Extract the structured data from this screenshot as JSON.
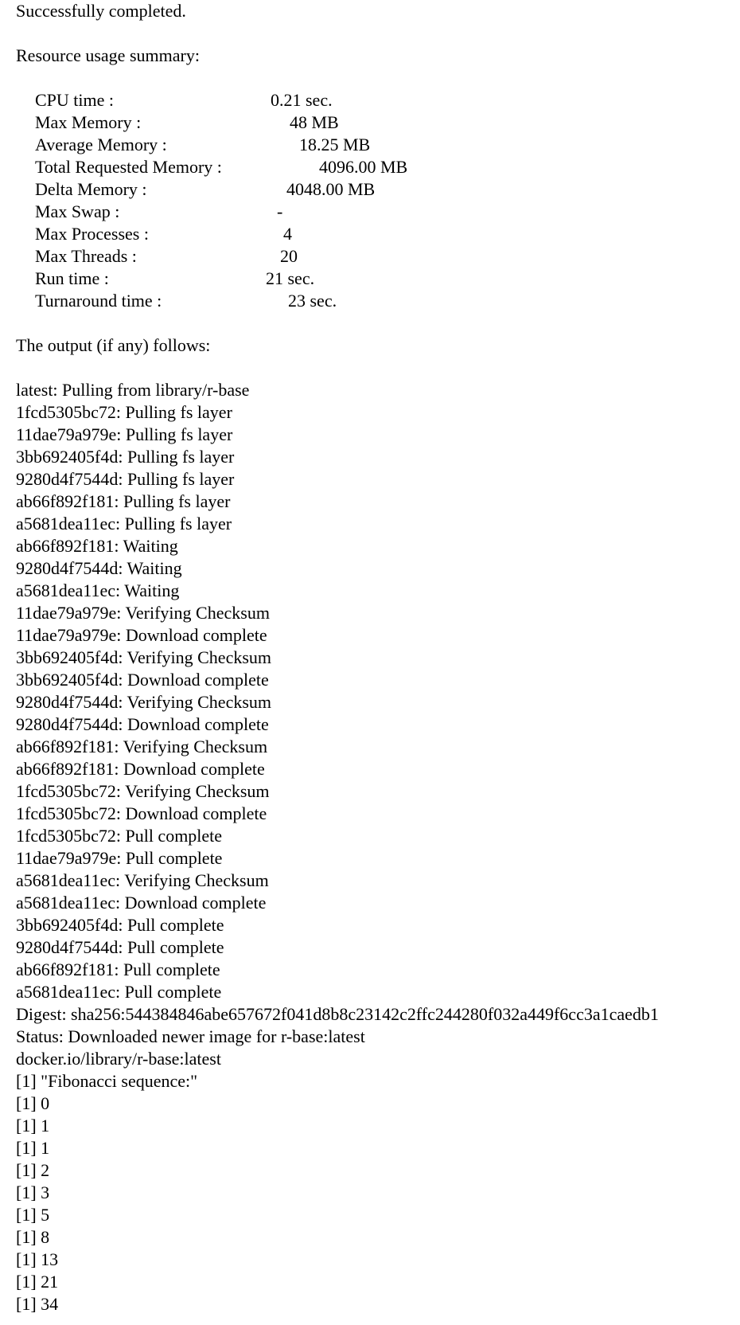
{
  "status_message": "Successfully completed.",
  "summary_heading": "Resource usage summary:",
  "usage": [
    {
      "label": "CPU time :",
      "value": "0.21 sec."
    },
    {
      "label": "Max Memory :",
      "value": "48 MB"
    },
    {
      "label": "Average Memory :",
      "value": "18.25 MB"
    },
    {
      "label": "Total Requested Memory :",
      "value": "4096.00 MB"
    },
    {
      "label": "Delta Memory :",
      "value": "4048.00 MB"
    },
    {
      "label": "Max Swap :",
      "value": "-"
    },
    {
      "label": "Max Processes :",
      "value": "4"
    },
    {
      "label": "Max Threads :",
      "value": "20"
    },
    {
      "label": "Run time :",
      "value": "21 sec."
    },
    {
      "label": "Turnaround time :",
      "value": "23 sec."
    }
  ],
  "output_heading": "The output (if any) follows:",
  "output_lines": [
    "latest: Pulling from library/r-base",
    "1fcd5305bc72: Pulling fs layer",
    "11dae79a979e: Pulling fs layer",
    "3bb692405f4d: Pulling fs layer",
    "9280d4f7544d: Pulling fs layer",
    "ab66f892f181: Pulling fs layer",
    "a5681dea11ec: Pulling fs layer",
    "ab66f892f181: Waiting",
    "9280d4f7544d: Waiting",
    "a5681dea11ec: Waiting",
    "11dae79a979e: Verifying Checksum",
    "11dae79a979e: Download complete",
    "3bb692405f4d: Verifying Checksum",
    "3bb692405f4d: Download complete",
    "9280d4f7544d: Verifying Checksum",
    "9280d4f7544d: Download complete",
    "ab66f892f181: Verifying Checksum",
    "ab66f892f181: Download complete",
    "1fcd5305bc72: Verifying Checksum",
    "1fcd5305bc72: Download complete",
    "1fcd5305bc72: Pull complete",
    "11dae79a979e: Pull complete",
    "a5681dea11ec: Verifying Checksum",
    "a5681dea11ec: Download complete",
    "3bb692405f4d: Pull complete",
    "9280d4f7544d: Pull complete",
    "ab66f892f181: Pull complete",
    "a5681dea11ec: Pull complete",
    "Digest: sha256:544384846abe657672f041d8b8c23142c2ffc244280f032a449f6cc3a1caedb1",
    "Status: Downloaded newer image for r-base:latest",
    "docker.io/library/r-base:latest",
    "[1] \"Fibonacci sequence:\"",
    "[1] 0",
    "[1] 1",
    "[1] 1",
    "[1] 2",
    "[1] 3",
    "[1] 5",
    "[1] 8",
    "[1] 13",
    "[1] 21",
    "[1] 34"
  ]
}
